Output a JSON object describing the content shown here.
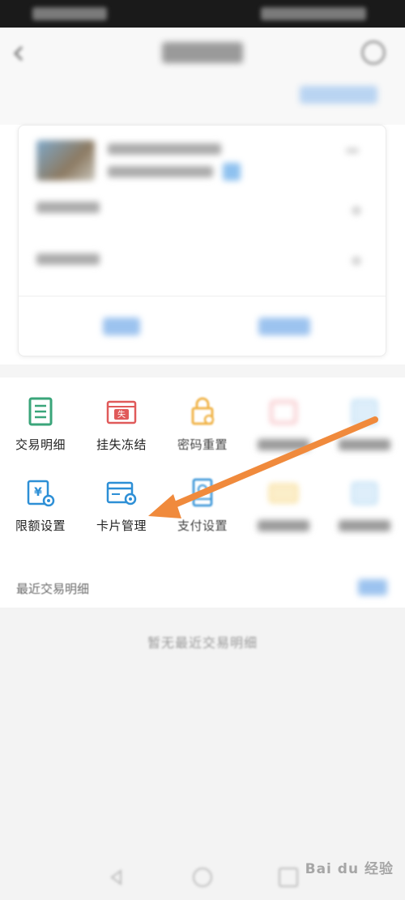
{
  "grid": {
    "row1": [
      {
        "label": "交易明细",
        "icon": "transaction-detail-icon",
        "color": "#3aa57a"
      },
      {
        "label": "挂失冻结",
        "icon": "report-loss-icon",
        "color": "#e05a5a",
        "glyph": "失"
      },
      {
        "label": "密码重置",
        "icon": "password-reset-icon",
        "color": "#f0b44a"
      },
      {
        "label": "",
        "icon": "blurred-icon-4",
        "color": "#f2a3a8"
      },
      {
        "label": "",
        "icon": "blurred-icon-5",
        "color": "#9fcdee"
      }
    ],
    "row2": [
      {
        "label": "限额设置",
        "icon": "limit-setting-icon",
        "color": "#2d8fd6",
        "glyph": "¥"
      },
      {
        "label": "卡片管理",
        "icon": "card-management-icon",
        "color": "#2d8fd6"
      },
      {
        "label": "支付设置",
        "icon": "payment-setting-icon",
        "color": "#2d8fd6"
      },
      {
        "label": "",
        "icon": "blurred-icon-9",
        "color": "#f5cf6f"
      },
      {
        "label": "",
        "icon": "blurred-icon-10",
        "color": "#9fcdee"
      }
    ]
  },
  "recent": {
    "title": "最近交易明细",
    "empty_text": "暂无最近交易明细"
  },
  "watermark": "Bai du 经验",
  "colors": {
    "accent_blue": "#2d8fd6",
    "arrow_orange": "#f08a3c",
    "bg_gray": "#f3f3f3"
  }
}
